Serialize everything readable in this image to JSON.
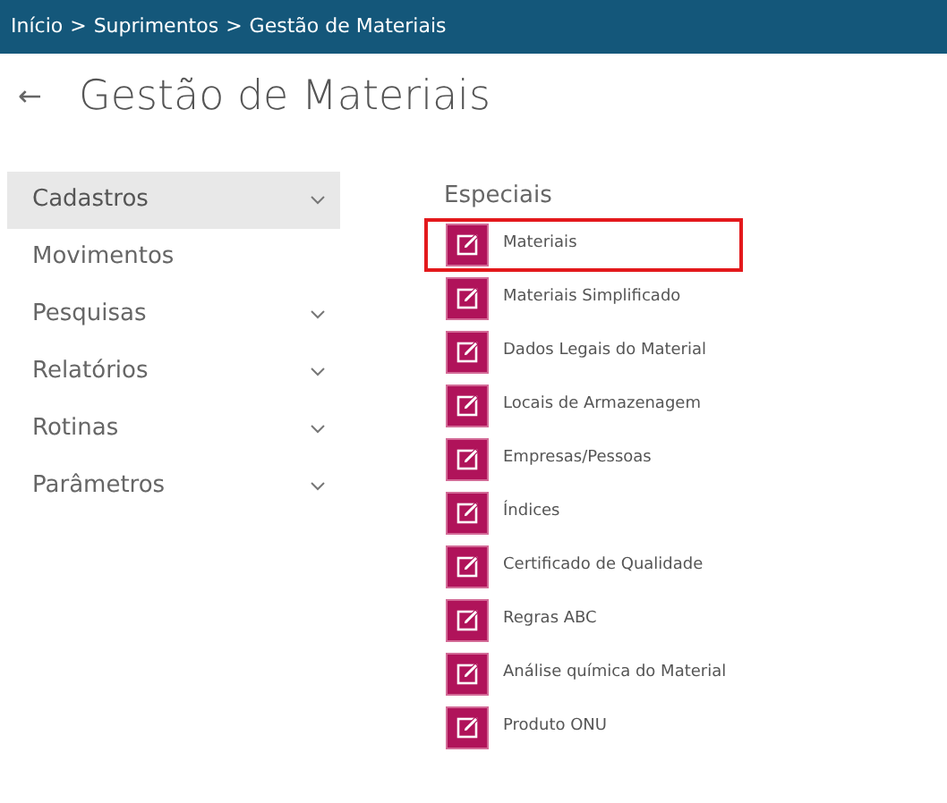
{
  "breadcrumb": [
    "Início",
    "Suprimentos",
    "Gestão de Materiais"
  ],
  "breadcrumb_separator": ">",
  "back_icon": "←",
  "title": "Gestão de Materiais",
  "sidebar": {
    "items": [
      {
        "label": "Cadastros",
        "selected": true,
        "has_submenu": true
      },
      {
        "label": "Movimentos",
        "selected": false,
        "has_submenu": false
      },
      {
        "label": "Pesquisas",
        "selected": false,
        "has_submenu": true
      },
      {
        "label": "Relatórios",
        "selected": false,
        "has_submenu": true
      },
      {
        "label": "Rotinas",
        "selected": false,
        "has_submenu": true
      },
      {
        "label": "Parâmetros",
        "selected": false,
        "has_submenu": true
      }
    ]
  },
  "section": {
    "title": "Especiais",
    "items": [
      {
        "label": "Materiais",
        "highlighted": true
      },
      {
        "label": "Materiais Simplificado",
        "highlighted": false
      },
      {
        "label": "Dados Legais do Material",
        "highlighted": false
      },
      {
        "label": "Locais de Armazenagem",
        "highlighted": false
      },
      {
        "label": "Empresas/Pessoas",
        "highlighted": false
      },
      {
        "label": "Índices",
        "highlighted": false
      },
      {
        "label": "Certificado de Qualidade",
        "highlighted": false
      },
      {
        "label": "Regras ABC",
        "highlighted": false
      },
      {
        "label": "Análise química do Material",
        "highlighted": false
      },
      {
        "label": "Produto ONU",
        "highlighted": false
      }
    ]
  }
}
